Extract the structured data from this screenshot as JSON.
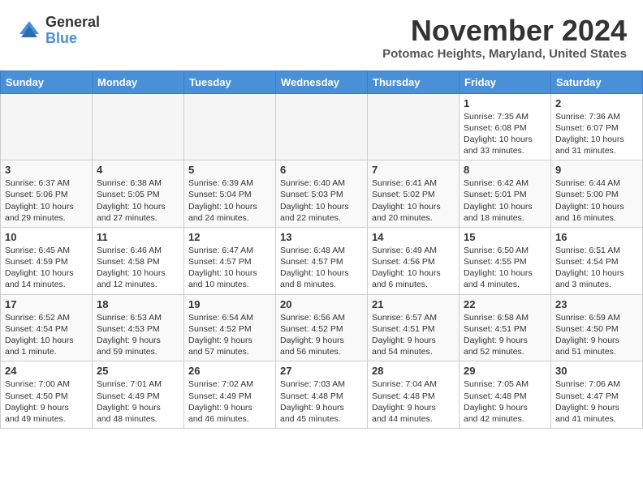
{
  "logo": {
    "general": "General",
    "blue": "Blue"
  },
  "header": {
    "month_year": "November 2024",
    "location": "Potomac Heights, Maryland, United States"
  },
  "days_of_week": [
    "Sunday",
    "Monday",
    "Tuesday",
    "Wednesday",
    "Thursday",
    "Friday",
    "Saturday"
  ],
  "weeks": [
    [
      {
        "day": "",
        "info": "",
        "empty": true
      },
      {
        "day": "",
        "info": "",
        "empty": true
      },
      {
        "day": "",
        "info": "",
        "empty": true
      },
      {
        "day": "",
        "info": "",
        "empty": true
      },
      {
        "day": "",
        "info": "",
        "empty": true
      },
      {
        "day": "1",
        "info": "Sunrise: 7:35 AM\nSunset: 6:08 PM\nDaylight: 10 hours\nand 33 minutes.",
        "empty": false
      },
      {
        "day": "2",
        "info": "Sunrise: 7:36 AM\nSunset: 6:07 PM\nDaylight: 10 hours\nand 31 minutes.",
        "empty": false
      }
    ],
    [
      {
        "day": "3",
        "info": "Sunrise: 6:37 AM\nSunset: 5:06 PM\nDaylight: 10 hours\nand 29 minutes.",
        "empty": false
      },
      {
        "day": "4",
        "info": "Sunrise: 6:38 AM\nSunset: 5:05 PM\nDaylight: 10 hours\nand 27 minutes.",
        "empty": false
      },
      {
        "day": "5",
        "info": "Sunrise: 6:39 AM\nSunset: 5:04 PM\nDaylight: 10 hours\nand 24 minutes.",
        "empty": false
      },
      {
        "day": "6",
        "info": "Sunrise: 6:40 AM\nSunset: 5:03 PM\nDaylight: 10 hours\nand 22 minutes.",
        "empty": false
      },
      {
        "day": "7",
        "info": "Sunrise: 6:41 AM\nSunset: 5:02 PM\nDaylight: 10 hours\nand 20 minutes.",
        "empty": false
      },
      {
        "day": "8",
        "info": "Sunrise: 6:42 AM\nSunset: 5:01 PM\nDaylight: 10 hours\nand 18 minutes.",
        "empty": false
      },
      {
        "day": "9",
        "info": "Sunrise: 6:44 AM\nSunset: 5:00 PM\nDaylight: 10 hours\nand 16 minutes.",
        "empty": false
      }
    ],
    [
      {
        "day": "10",
        "info": "Sunrise: 6:45 AM\nSunset: 4:59 PM\nDaylight: 10 hours\nand 14 minutes.",
        "empty": false
      },
      {
        "day": "11",
        "info": "Sunrise: 6:46 AM\nSunset: 4:58 PM\nDaylight: 10 hours\nand 12 minutes.",
        "empty": false
      },
      {
        "day": "12",
        "info": "Sunrise: 6:47 AM\nSunset: 4:57 PM\nDaylight: 10 hours\nand 10 minutes.",
        "empty": false
      },
      {
        "day": "13",
        "info": "Sunrise: 6:48 AM\nSunset: 4:57 PM\nDaylight: 10 hours\nand 8 minutes.",
        "empty": false
      },
      {
        "day": "14",
        "info": "Sunrise: 6:49 AM\nSunset: 4:56 PM\nDaylight: 10 hours\nand 6 minutes.",
        "empty": false
      },
      {
        "day": "15",
        "info": "Sunrise: 6:50 AM\nSunset: 4:55 PM\nDaylight: 10 hours\nand 4 minutes.",
        "empty": false
      },
      {
        "day": "16",
        "info": "Sunrise: 6:51 AM\nSunset: 4:54 PM\nDaylight: 10 hours\nand 3 minutes.",
        "empty": false
      }
    ],
    [
      {
        "day": "17",
        "info": "Sunrise: 6:52 AM\nSunset: 4:54 PM\nDaylight: 10 hours\nand 1 minute.",
        "empty": false
      },
      {
        "day": "18",
        "info": "Sunrise: 6:53 AM\nSunset: 4:53 PM\nDaylight: 9 hours\nand 59 minutes.",
        "empty": false
      },
      {
        "day": "19",
        "info": "Sunrise: 6:54 AM\nSunset: 4:52 PM\nDaylight: 9 hours\nand 57 minutes.",
        "empty": false
      },
      {
        "day": "20",
        "info": "Sunrise: 6:56 AM\nSunset: 4:52 PM\nDaylight: 9 hours\nand 56 minutes.",
        "empty": false
      },
      {
        "day": "21",
        "info": "Sunrise: 6:57 AM\nSunset: 4:51 PM\nDaylight: 9 hours\nand 54 minutes.",
        "empty": false
      },
      {
        "day": "22",
        "info": "Sunrise: 6:58 AM\nSunset: 4:51 PM\nDaylight: 9 hours\nand 52 minutes.",
        "empty": false
      },
      {
        "day": "23",
        "info": "Sunrise: 6:59 AM\nSunset: 4:50 PM\nDaylight: 9 hours\nand 51 minutes.",
        "empty": false
      }
    ],
    [
      {
        "day": "24",
        "info": "Sunrise: 7:00 AM\nSunset: 4:50 PM\nDaylight: 9 hours\nand 49 minutes.",
        "empty": false
      },
      {
        "day": "25",
        "info": "Sunrise: 7:01 AM\nSunset: 4:49 PM\nDaylight: 9 hours\nand 48 minutes.",
        "empty": false
      },
      {
        "day": "26",
        "info": "Sunrise: 7:02 AM\nSunset: 4:49 PM\nDaylight: 9 hours\nand 46 minutes.",
        "empty": false
      },
      {
        "day": "27",
        "info": "Sunrise: 7:03 AM\nSunset: 4:48 PM\nDaylight: 9 hours\nand 45 minutes.",
        "empty": false
      },
      {
        "day": "28",
        "info": "Sunrise: 7:04 AM\nSunset: 4:48 PM\nDaylight: 9 hours\nand 44 minutes.",
        "empty": false
      },
      {
        "day": "29",
        "info": "Sunrise: 7:05 AM\nSunset: 4:48 PM\nDaylight: 9 hours\nand 42 minutes.",
        "empty": false
      },
      {
        "day": "30",
        "info": "Sunrise: 7:06 AM\nSunset: 4:47 PM\nDaylight: 9 hours\nand 41 minutes.",
        "empty": false
      }
    ]
  ]
}
